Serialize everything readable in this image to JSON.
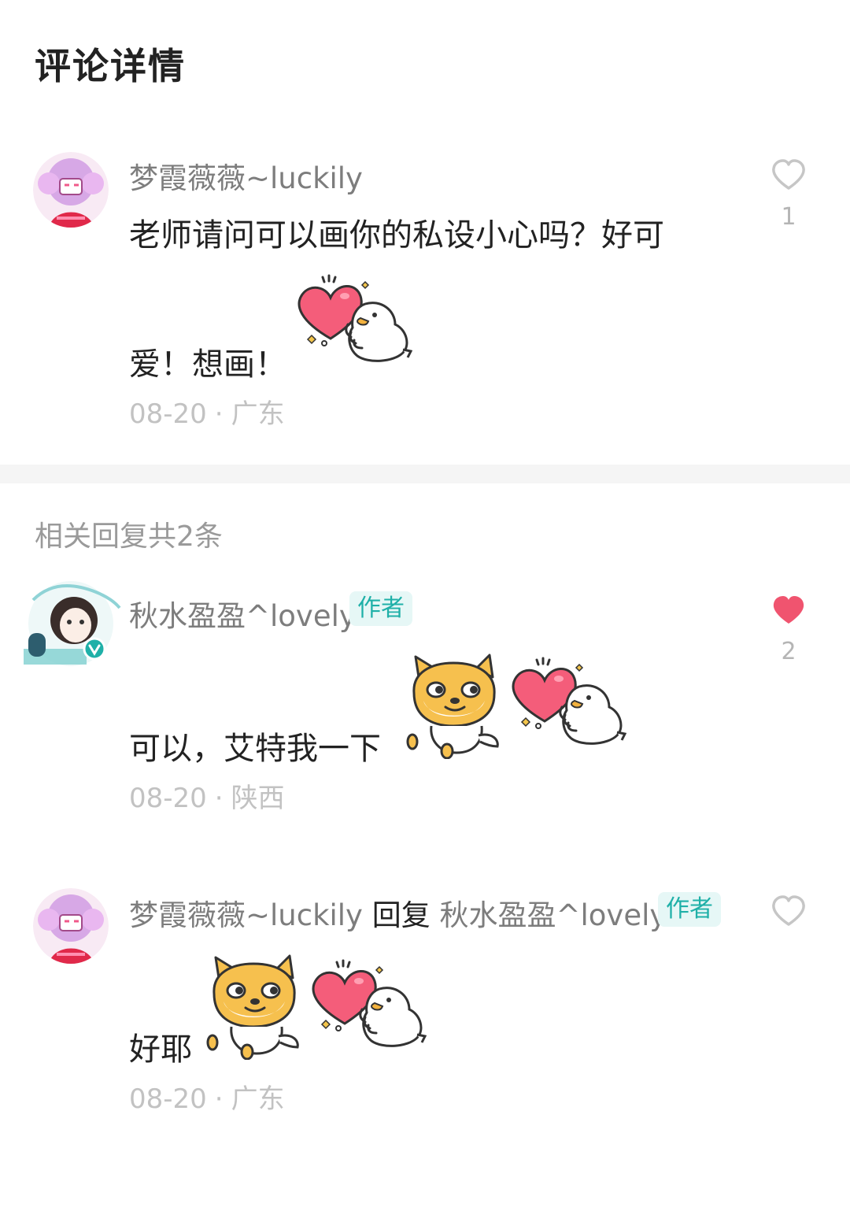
{
  "header": {
    "title": "评论详情"
  },
  "main_comment": {
    "username": "梦霞薇薇~luckily",
    "text_line1": "老师请问可以画你的私设小心吗？好可",
    "text_line2": "爱！想画！",
    "date": "08-20",
    "location": "广东",
    "separator": "·",
    "like_count": "1",
    "liked": false
  },
  "replies_header": "相关回复共2条",
  "replies": [
    {
      "username": "秋水盈盈^lovely",
      "badge": "作者",
      "text": "可以，艾特我一下",
      "date": "08-20",
      "location": "陕西",
      "separator": "·",
      "like_count": "2",
      "liked": true
    },
    {
      "username": "梦霞薇薇~luckily",
      "reply_word": "回复",
      "reply_to": "秋水盈盈^lovely",
      "badge": "作者",
      "text": "好耶",
      "date": "08-20",
      "location": "广东",
      "separator": "·",
      "liked": false
    }
  ],
  "colors": {
    "like_active": "#f0546f",
    "badge_text": "#1fb0a8",
    "badge_bg": "#e6f7f6"
  },
  "icons": [
    "heart-outline-icon",
    "heart-filled-icon",
    "heart-duck-sticker",
    "shiba-dog-sticker"
  ]
}
